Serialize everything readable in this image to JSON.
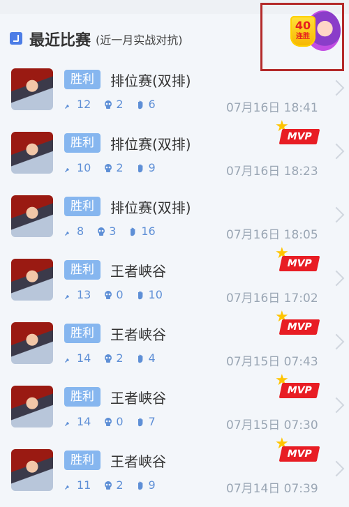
{
  "header": {
    "title": "最近比赛",
    "subtitle": "(近一月实战对抗)"
  },
  "streak": {
    "count": "40",
    "label": "连胜"
  },
  "matches": [
    {
      "result": "胜利",
      "mode": "排位赛(双排)",
      "kills": "12",
      "deaths": "2",
      "assists": "6",
      "time": "07月16日 18:41",
      "mvp": ""
    },
    {
      "result": "胜利",
      "mode": "排位赛(双排)",
      "kills": "10",
      "deaths": "2",
      "assists": "9",
      "time": "07月16日 18:23",
      "mvp": "MVP"
    },
    {
      "result": "胜利",
      "mode": "排位赛(双排)",
      "kills": "8",
      "deaths": "3",
      "assists": "16",
      "time": "07月16日 18:05",
      "mvp": ""
    },
    {
      "result": "胜利",
      "mode": "王者峡谷",
      "kills": "13",
      "deaths": "0",
      "assists": "10",
      "time": "07月16日 17:02",
      "mvp": "MVP"
    },
    {
      "result": "胜利",
      "mode": "王者峡谷",
      "kills": "14",
      "deaths": "2",
      "assists": "4",
      "time": "07月15日 07:43",
      "mvp": "MVP"
    },
    {
      "result": "胜利",
      "mode": "王者峡谷",
      "kills": "14",
      "deaths": "0",
      "assists": "7",
      "time": "07月15日 07:30",
      "mvp": "MVP"
    },
    {
      "result": "胜利",
      "mode": "王者峡谷",
      "kills": "11",
      "deaths": "2",
      "assists": "9",
      "time": "07月14日 07:39",
      "mvp": "MVP"
    }
  ],
  "colors": {
    "tag": "#86b6ef",
    "stat": "#5e8fd6",
    "mvp": "#e81d24",
    "accent": "#4c7de6"
  }
}
